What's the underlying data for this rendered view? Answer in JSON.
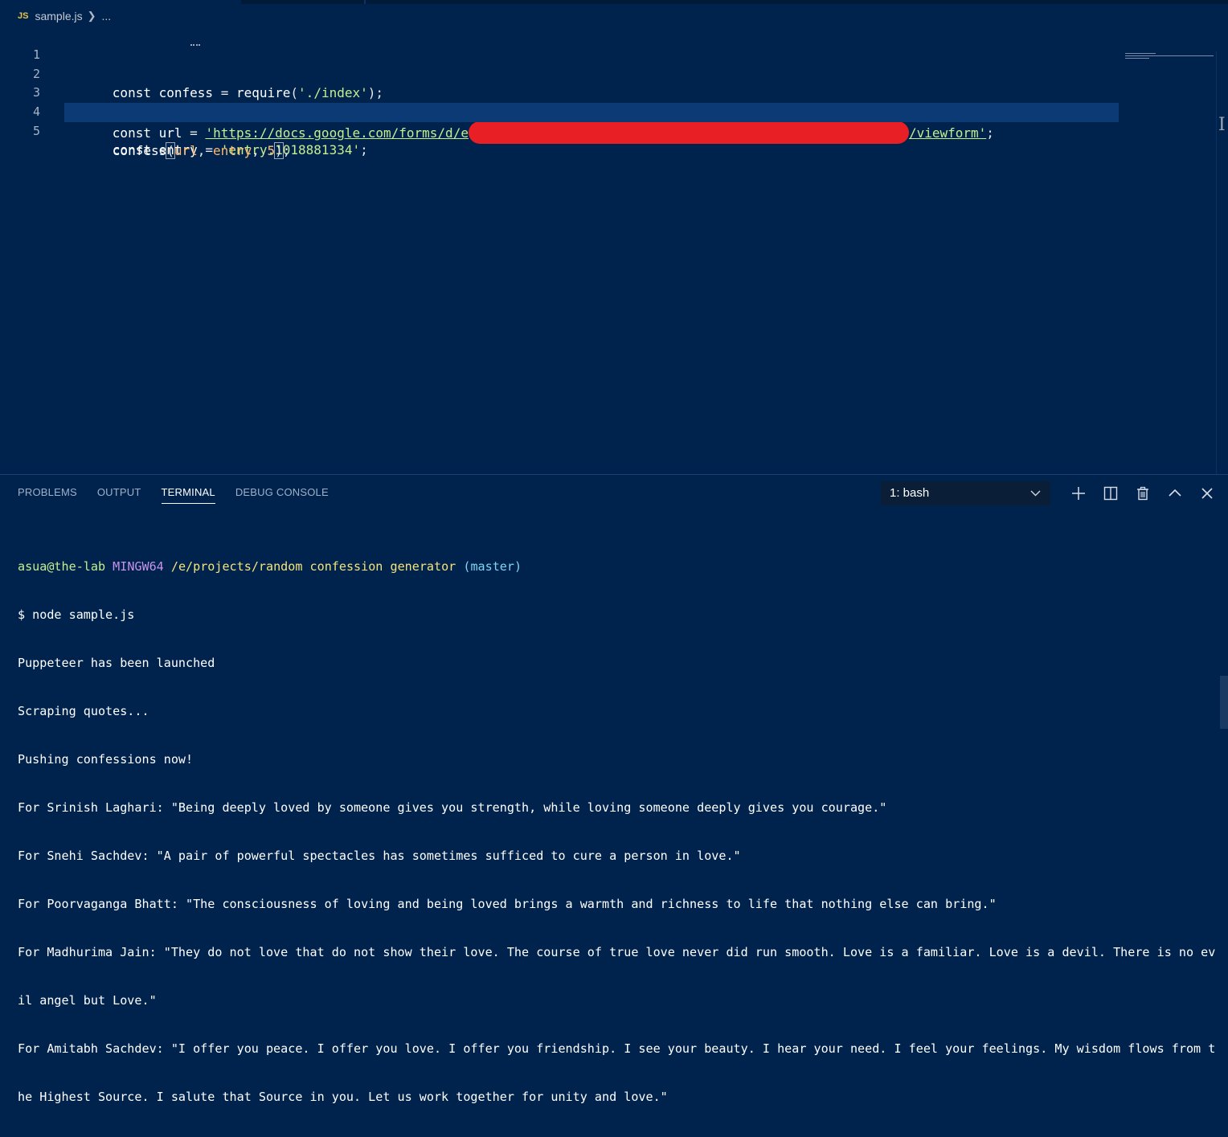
{
  "breadcrumb": {
    "file_icon": "JS",
    "file": "sample.js",
    "more": "..."
  },
  "editor": {
    "line_numbers": [
      "1",
      "2",
      "3",
      "4",
      "5"
    ],
    "lines": {
      "l1": {
        "kw": "const",
        "name": "confess",
        "eq": "=",
        "fn": "require",
        "arg": "'./index'",
        "end": ");"
      },
      "l3": {
        "kw": "const",
        "name": "url",
        "eq": "=",
        "str_start": "'https://docs.google.com/forms/d/e",
        "str_end": "/viewform'",
        "end": ";"
      },
      "l4": {
        "kw": "const",
        "name": "entry",
        "eq": "=",
        "str": "'entry.1018881334'",
        "end": ";"
      },
      "l5": {
        "fn": "confess",
        "p1": "url",
        "p2": "entry",
        "num": "5",
        "end": ";"
      }
    }
  },
  "panel": {
    "tabs": [
      "PROBLEMS",
      "OUTPUT",
      "TERMINAL",
      "DEBUG CONSOLE"
    ],
    "active_tab": "TERMINAL",
    "terminal_select": "1: bash",
    "prompt": {
      "user": "asua@the-lab",
      "host": "MINGW64",
      "path": "/e/projects/random confession generator",
      "branch": "(master)"
    },
    "output": [
      "$ node sample.js",
      "Puppeteer has been launched",
      "Scraping quotes...",
      "Pushing confessions now!",
      "For Srinish Laghari: \"Being deeply loved by someone gives you strength, while loving someone deeply gives you courage.\"",
      "For Snehi Sachdev: \"A pair of powerful spectacles has sometimes sufficed to cure a person in love.\"",
      "For Poorvaganga Bhatt: \"The consciousness of loving and being loved brings a warmth and richness to life that nothing else can bring.\"",
      "For Madhurima Jain: \"They do not love that do not show their love. The course of true love never did run smooth. Love is a familiar. Love is a devil. There is no ev",
      "il angel but Love.\"",
      "For Amitabh Sachdev: \"I offer you peace. I offer you love. I offer you friendship. I see your beauty. I hear your need. I feel your feelings. My wisdom flows from t",
      "he Highest Source. I salute that Source in you. Let us work together for unity and love.\""
    ]
  }
}
